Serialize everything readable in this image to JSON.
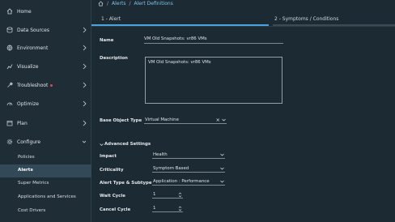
{
  "sidebar": {
    "items": [
      {
        "label": "Home",
        "icon": "home-icon"
      },
      {
        "label": "Data Sources",
        "icon": "database-icon"
      },
      {
        "label": "Environment",
        "icon": "globe-icon"
      },
      {
        "label": "Visualize",
        "icon": "chart-icon"
      },
      {
        "label": "Troubleshoot",
        "icon": "wrench-icon"
      },
      {
        "label": "Optimize",
        "icon": "gauge-icon"
      },
      {
        "label": "Plan",
        "icon": "calendar-icon"
      },
      {
        "label": "Configure",
        "icon": "gear-icon"
      }
    ],
    "sub_items": [
      {
        "label": "Policies"
      },
      {
        "label": "Alerts"
      },
      {
        "label": "Super Metrics"
      },
      {
        "label": "Applications and Services"
      },
      {
        "label": "Cost Drivers"
      }
    ]
  },
  "breadcrumb": {
    "sep": "/",
    "items": [
      "Alerts",
      "Alert Definitions"
    ]
  },
  "steps": [
    {
      "label": "1 - Alert"
    },
    {
      "label": "2 - Symptoms / Conditions"
    }
  ],
  "form": {
    "name_label": "Name",
    "name_value": "VM Old Snapshots: vr86 VMs",
    "description_label": "Description",
    "description_value": "VM Old Snapshots: vr86 VMs",
    "base_object_label": "Base Object Type",
    "base_object_value": "Virtual Machine",
    "clear_symbol": "×",
    "advanced_title": "Advanced Settings",
    "impact_label": "Impact",
    "impact_value": "Health",
    "criticality_label": "Criticality",
    "criticality_value": "Symptom Based",
    "type_label": "Alert Type & Subtype",
    "type_value": "Application : Performance",
    "wait_label": "Wait Cycle",
    "wait_value": "1",
    "cancel_label": "Cancel Cycle",
    "cancel_value": "1"
  },
  "colors": {
    "accent": "#4aa3df",
    "link": "#7fc4ec",
    "alert_dot": "#e0484d",
    "background": "#1b2a33",
    "sidebar": "#1f2d36"
  }
}
